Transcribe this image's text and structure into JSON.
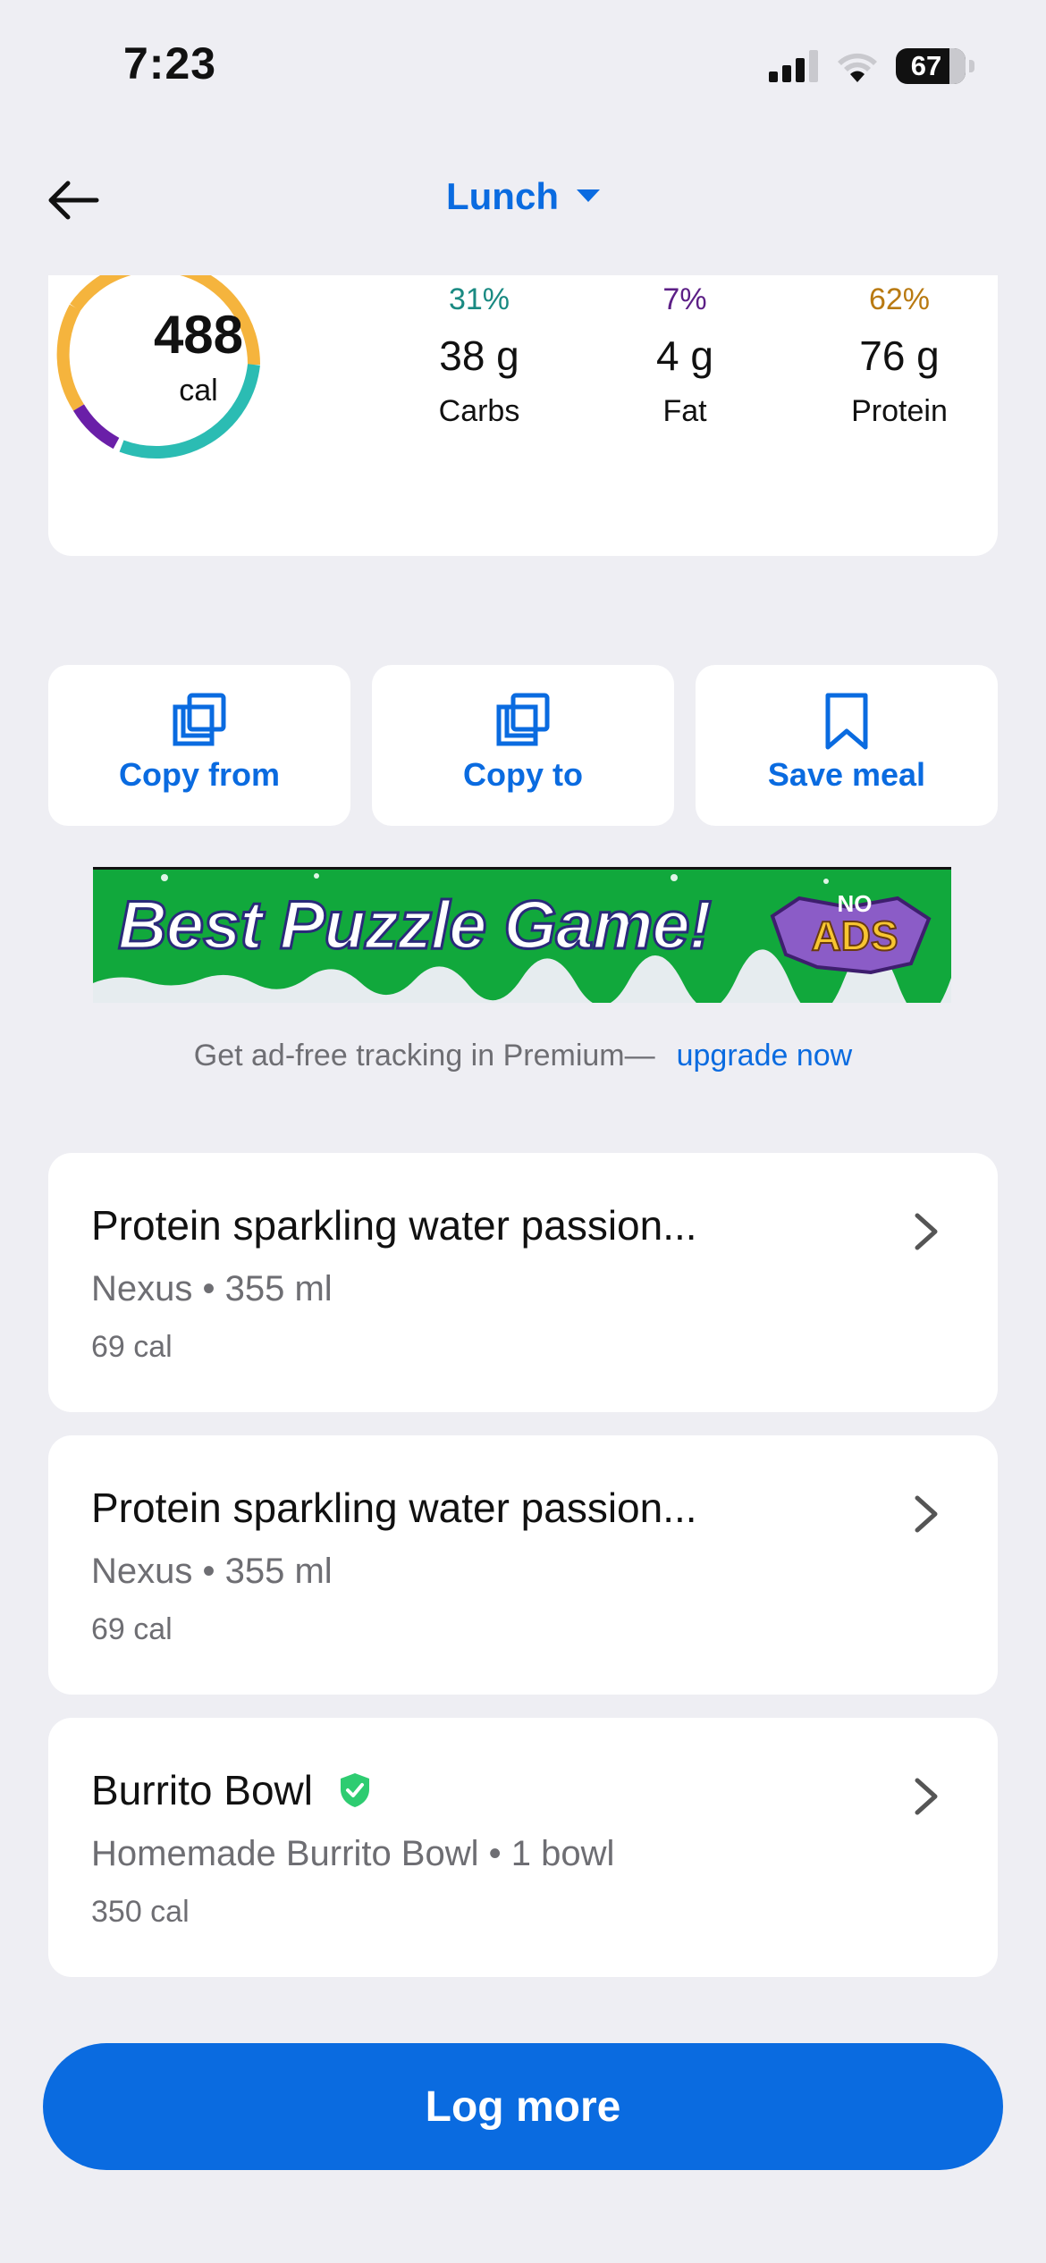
{
  "status": {
    "time": "7:23",
    "battery": "67"
  },
  "header": {
    "title": "Lunch"
  },
  "summary": {
    "calories": "488",
    "calories_unit": "cal",
    "macros": [
      {
        "pct": "31%",
        "amount": "38 g",
        "label": "Carbs",
        "color": "#1a8a82"
      },
      {
        "pct": "7%",
        "amount": "4 g",
        "label": "Fat",
        "color": "#5c1f86"
      },
      {
        "pct": "62%",
        "amount": "76 g",
        "label": "Protein",
        "color": "#b97a12"
      }
    ],
    "ring_colors": {
      "carbs": "#2bbcb3",
      "fat": "#6a1fa8",
      "protein": "#f5b43d"
    }
  },
  "actions": [
    {
      "label": "Copy from",
      "icon": "copy-icon"
    },
    {
      "label": "Copy to",
      "icon": "copy-icon"
    },
    {
      "label": "Save meal",
      "icon": "bookmark-icon"
    }
  ],
  "ad": {
    "headline": "Best Puzzle Game!",
    "badge_top": "NO",
    "badge_bottom": "ADS",
    "note": "Get ad-free tracking in Premium—",
    "link": "upgrade now"
  },
  "foods": [
    {
      "name": "Protein sparkling  water  passion...",
      "detail": "Nexus • 355 ml",
      "calories": "69 cal",
      "verified": false
    },
    {
      "name": "Protein sparkling  water  passion...",
      "detail": "Nexus • 355 ml",
      "calories": "69 cal",
      "verified": false
    },
    {
      "name": "Burrito Bowl",
      "detail": "Homemade Burrito Bowl • 1 bowl",
      "calories": "350 cal",
      "verified": true
    }
  ],
  "log_more": "Log more",
  "colors": {
    "accent": "#0a6be0",
    "background": "#eeeef3",
    "verified": "#2ecc71"
  }
}
